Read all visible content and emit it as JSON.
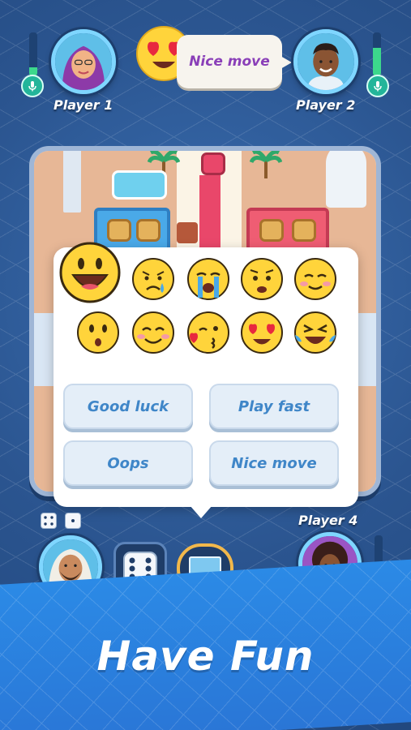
{
  "players": {
    "p1": {
      "name": "Player 1",
      "volume_level": 0.2
    },
    "p2": {
      "name": "Player 2",
      "volume_level": 0.65
    },
    "p4": {
      "name": "Player 4",
      "volume_level": 0.3
    }
  },
  "top_message": {
    "emoji": "heart-eyes",
    "text": "Nice move"
  },
  "chat": {
    "emojis": [
      "big-smile",
      "sad-tear",
      "crying",
      "worried",
      "content-smile",
      "surprised",
      "blush-smile",
      "kiss",
      "heart-eyes",
      "laughing-tears"
    ],
    "quick_messages": [
      "Good luck",
      "Play fast",
      "Oops",
      "Nice move"
    ]
  },
  "headline": "Have Fun",
  "colors": {
    "accent_blue": "#3f86c8",
    "message_purple": "#8a3fb8",
    "mic_green": "#23b59a",
    "board_red": "#ef5d73",
    "board_blue": "#4aa9e8"
  }
}
